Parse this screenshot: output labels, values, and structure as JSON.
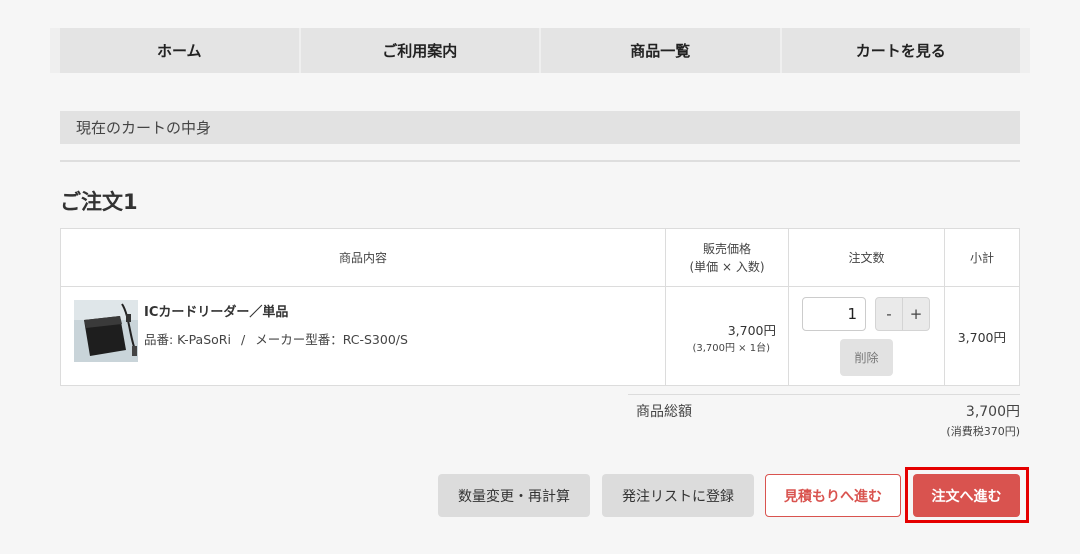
{
  "nav": {
    "items": [
      {
        "label": "ホーム"
      },
      {
        "label": "ご利用案内"
      },
      {
        "label": "商品一覧"
      },
      {
        "label": "カートを見る"
      }
    ]
  },
  "section": {
    "title": "現在のカートの中身"
  },
  "order": {
    "title": "ご注文1"
  },
  "table": {
    "headers": {
      "product": "商品内容",
      "price_line1": "販売価格",
      "price_line2": "(単価 × 入数)",
      "qty": "注文数",
      "subtotal": "小計"
    },
    "rows": [
      {
        "image": "ic-card-reader-image",
        "name": "ICカードリーダー／単品",
        "code": "品番: K-PaSoRi",
        "separator": "/",
        "maker_code": "メーカー型番：RC-S300/S",
        "price": "3,700円",
        "price_detail": "(3,700円 × 1台)",
        "qty": "1",
        "minus": "-",
        "plus": "+",
        "delete": "削除",
        "subtotal": "3,700円"
      }
    ]
  },
  "totals": {
    "label": "商品総額",
    "value": "3,700円",
    "tax": "(消費税370円)"
  },
  "buttons": {
    "recalc": "数量変更・再計算",
    "orderlist": "発注リストに登録",
    "estimate": "見積もりへ進む",
    "proceed": "注文へ進む"
  },
  "colors": {
    "accent": "#d9534f",
    "highlight": "#e50000",
    "nav_bg": "#e4e4e4"
  }
}
